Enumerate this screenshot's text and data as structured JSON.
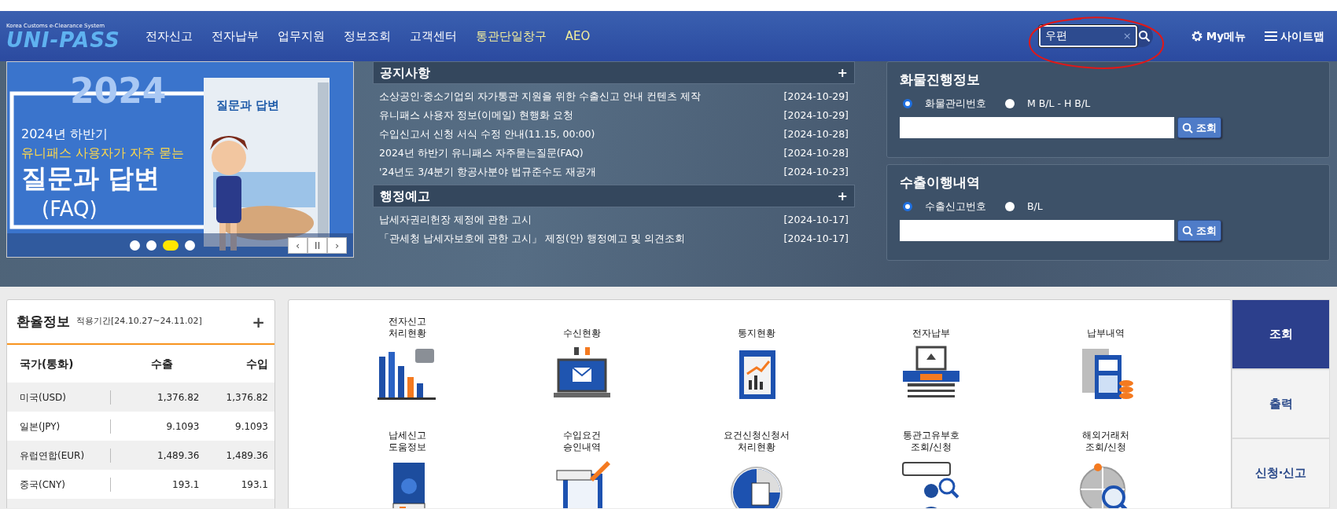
{
  "logo": {
    "tagline": "Korea Customs e-Clearance System",
    "wordmark": "UNI-PASS"
  },
  "nav": [
    {
      "label": "전자신고",
      "color": "#ffffff"
    },
    {
      "label": "전자납부",
      "color": "#ffffff"
    },
    {
      "label": "업무지원",
      "color": "#ffffff"
    },
    {
      "label": "정보조회",
      "color": "#ffffff"
    },
    {
      "label": "고객센터",
      "color": "#ffffff"
    },
    {
      "label": "통관단일창구",
      "color": "#f4ef9c"
    },
    {
      "label": "AEO",
      "color": "#f4ef9c"
    }
  ],
  "search": {
    "value": "우편",
    "clear": "×"
  },
  "utility": [
    {
      "label": "My메뉴",
      "kind": "gear"
    },
    {
      "label": "사이트맵",
      "kind": "menu"
    }
  ],
  "banner": {
    "year": "2024",
    "line1": "2024년 하반기",
    "line2": "유니패스 사용자가 자주 묻는",
    "title": "질문과 답변",
    "sub": "(FAQ)",
    "book_title": "질문과 답변",
    "dots": [
      {
        "selected": false
      },
      {
        "selected": false
      },
      {
        "selected": true
      },
      {
        "selected": false
      }
    ],
    "controls": [
      "‹",
      "II",
      "›"
    ]
  },
  "notices": [
    {
      "title": "공지사항",
      "more": "+",
      "items": [
        {
          "text": "소상공인·중소기업의 자가통관 지원을 위한 수출신고 안내 컨텐츠 제작",
          "date": "[2024-10-29]"
        },
        {
          "text": "유니패스 사용자 정보(이메일) 현행화 요청",
          "date": "[2024-10-29]"
        },
        {
          "text": "수입신고서 신청 서식 수정 안내(11.15, 00:00)",
          "date": "[2024-10-28]"
        },
        {
          "text": "2024년 하반기 유니패스 자주묻는질문(FAQ)",
          "date": "[2024-10-28]"
        },
        {
          "text": "'24년도 3/4분기 항공사분야 법규준수도 재공개",
          "date": "[2024-10-23]"
        }
      ]
    },
    {
      "title": "행정예고",
      "more": "+",
      "items": [
        {
          "text": "납세자권리헌장 제정에 관한 고시",
          "date": "[2024-10-17]"
        },
        {
          "text": "「관세청 납세자보호에 관한 고시」 제정(안) 행정예고 및 의견조회",
          "date": "[2024-10-17]"
        }
      ]
    }
  ],
  "lookups": [
    {
      "title": "화물진행정보",
      "options": [
        {
          "label": "화물관리번호",
          "selected": true
        },
        {
          "label": "M B/L - H B/L",
          "selected": false
        }
      ],
      "button": "조회"
    },
    {
      "title": "수출이행내역",
      "options": [
        {
          "label": "수출신고번호",
          "selected": true
        },
        {
          "label": "B/L",
          "selected": false
        }
      ],
      "button": "조회"
    }
  ],
  "exchange": {
    "title": "환율정보",
    "period": "적용기간[24.10.27~24.11.02]",
    "more": "+",
    "columns": [
      "국가(통화)",
      "수출",
      "수입"
    ],
    "rows": [
      [
        "미국(USD)",
        "1,376.82",
        "1,376.82"
      ],
      [
        "일본(JPY)",
        "9.1093",
        "9.1093"
      ],
      [
        "유럽연합(EUR)",
        "1,489.36",
        "1,489.36"
      ],
      [
        "중국(CNY)",
        "193.1",
        "193.1"
      ]
    ]
  },
  "services": [
    {
      "label": "전자신고\n처리현황"
    },
    {
      "label": "수신현황"
    },
    {
      "label": "통지현황"
    },
    {
      "label": "전자납부"
    },
    {
      "label": "납부내역"
    },
    {
      "label": "납세신고\n도움정보"
    },
    {
      "label": "수입요건\n승인내역"
    },
    {
      "label": "요건신청신청서\n처리현황"
    },
    {
      "label": "통관고유부호\n조회/신청"
    },
    {
      "label": "해외거래처\n조회/신청"
    }
  ],
  "side_tabs": [
    {
      "label": "조회",
      "selected": true
    },
    {
      "label": "출력",
      "selected": false
    },
    {
      "label": "신청·신고",
      "selected": false
    }
  ]
}
